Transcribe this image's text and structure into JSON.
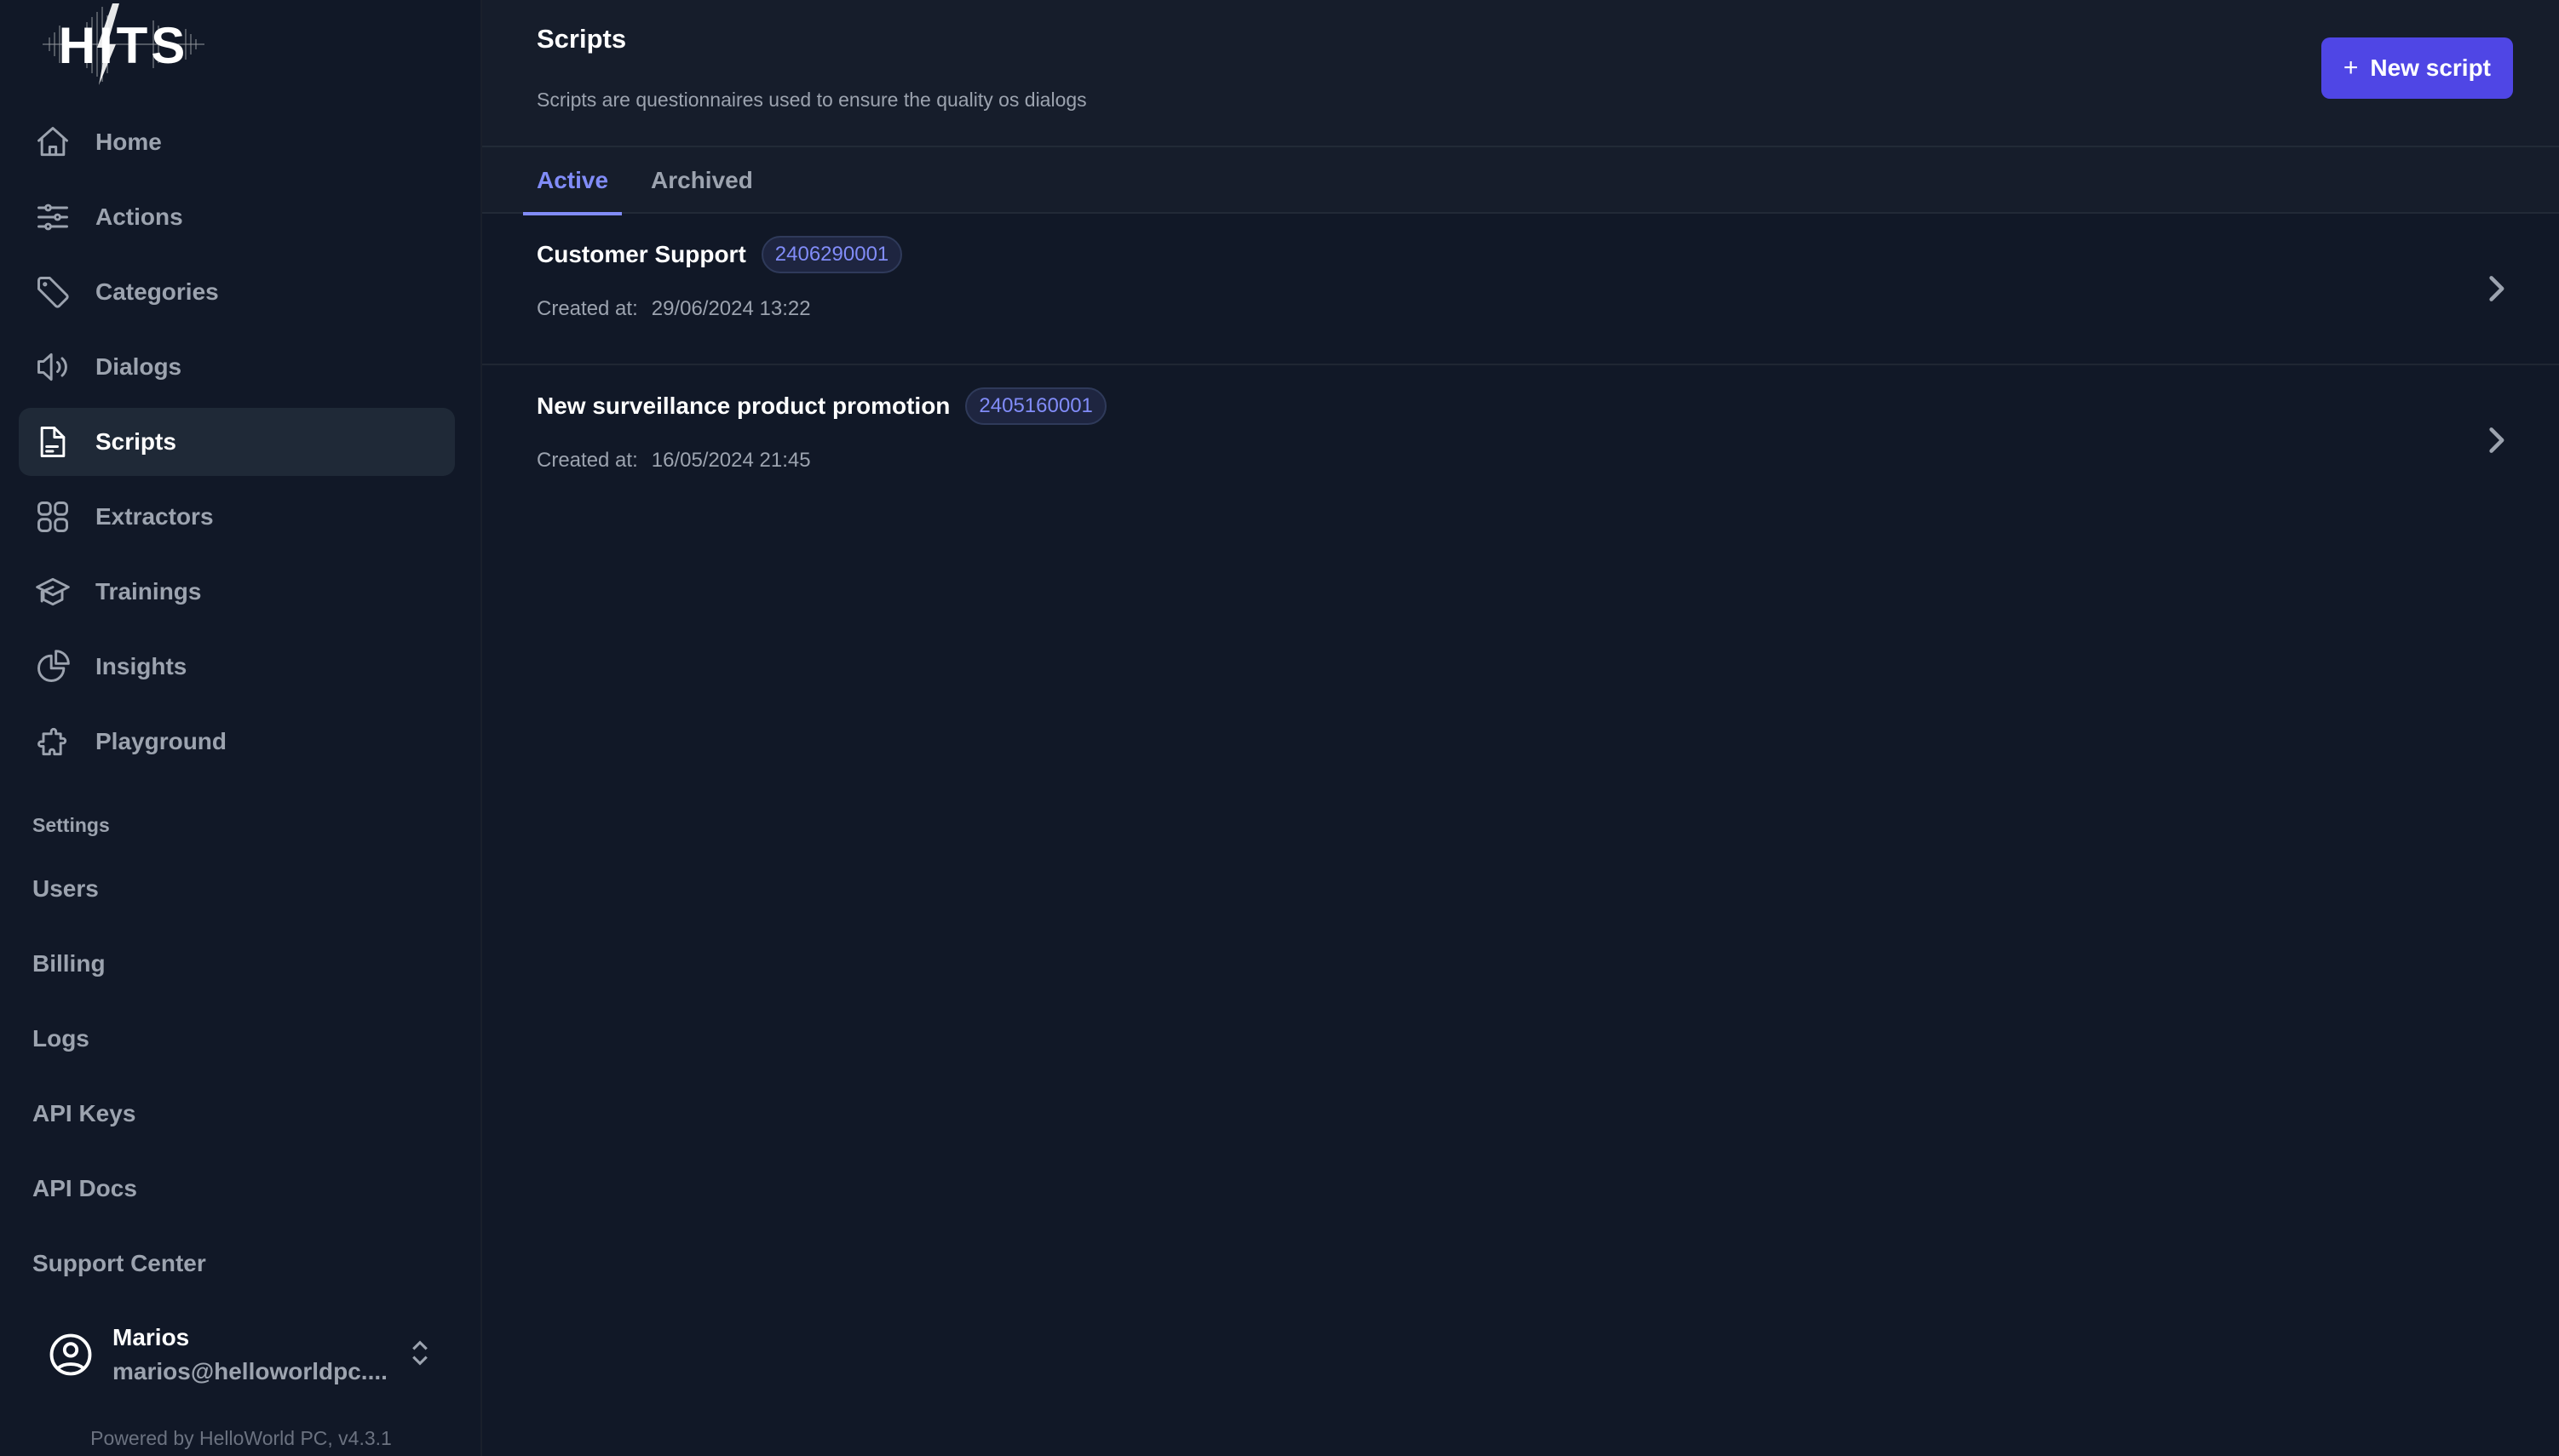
{
  "app": {
    "logo_text": "HITS"
  },
  "sidebar": {
    "items": [
      {
        "label": "Home",
        "icon": "home-icon",
        "active": false
      },
      {
        "label": "Actions",
        "icon": "sliders-icon",
        "active": false
      },
      {
        "label": "Categories",
        "icon": "tag-icon",
        "active": false
      },
      {
        "label": "Dialogs",
        "icon": "speaker-icon",
        "active": false
      },
      {
        "label": "Scripts",
        "icon": "document-icon",
        "active": true
      },
      {
        "label": "Extractors",
        "icon": "grid-icon",
        "active": false
      },
      {
        "label": "Trainings",
        "icon": "graduation-cap-icon",
        "active": false
      },
      {
        "label": "Insights",
        "icon": "pie-chart-icon",
        "active": false
      },
      {
        "label": "Playground",
        "icon": "puzzle-icon",
        "active": false
      }
    ],
    "settings_title": "Settings",
    "settings_items": [
      "Users",
      "Billing",
      "Logs",
      "API Keys",
      "API Docs",
      "Support Center"
    ],
    "user": {
      "name": "Marios",
      "email": "marios@helloworldpc...."
    },
    "powered_by": "Powered by HelloWorld PC, v4.3.1"
  },
  "header": {
    "title": "Scripts",
    "description": "Scripts are questionnaires used to ensure the quality os dialogs",
    "new_button_label": "New script",
    "new_button_icon": "+"
  },
  "tabs": [
    {
      "label": "Active",
      "active": true
    },
    {
      "label": "Archived",
      "active": false
    }
  ],
  "scripts": [
    {
      "title": "Customer Support",
      "id": "2406290001",
      "created_label": "Created at:",
      "created_at": "29/06/2024 13:22"
    },
    {
      "title": "New surveillance product promotion",
      "id": "2405160001",
      "created_label": "Created at:",
      "created_at": "16/05/2024 21:45"
    }
  ],
  "colors": {
    "accent": "#4f46e5",
    "accent_text": "#818cf8",
    "background": "#111827",
    "header_bg": "#161d2b"
  }
}
